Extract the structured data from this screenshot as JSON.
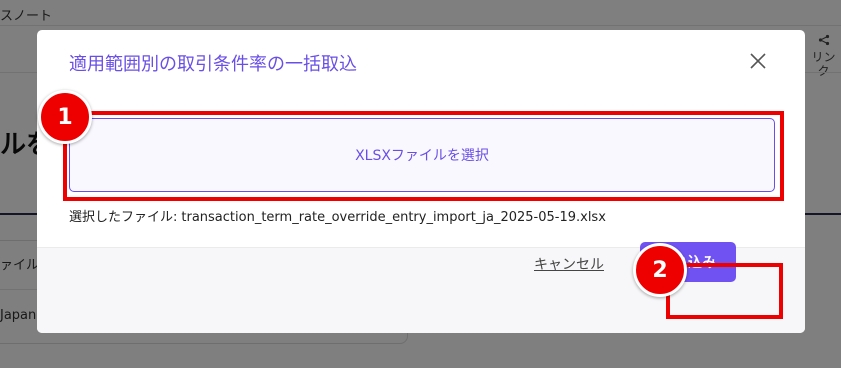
{
  "background": {
    "app_title": "スノート",
    "share_label": "リンク",
    "heading": "ルを",
    "table_header_cell": "ァイル",
    "table_cell": "Japan"
  },
  "modal": {
    "title": "適用範囲別の取引条件率の一括取込",
    "select_button_label": "XLSXファイルを選択",
    "selected_file_label": "選択したファイル:",
    "selected_file_name": "transaction_term_rate_override_entry_import_ja_2025-05-19.xlsx",
    "cancel_label": "キャンセル",
    "import_label": "取り込み"
  },
  "annotations": {
    "badge_1": "1",
    "badge_2": "2",
    "highlight_color": "#ee0000"
  },
  "colors": {
    "accent": "#6a4fe6",
    "primary_button": "#7052f3"
  },
  "icons": [
    "close-icon",
    "share-icon"
  ]
}
